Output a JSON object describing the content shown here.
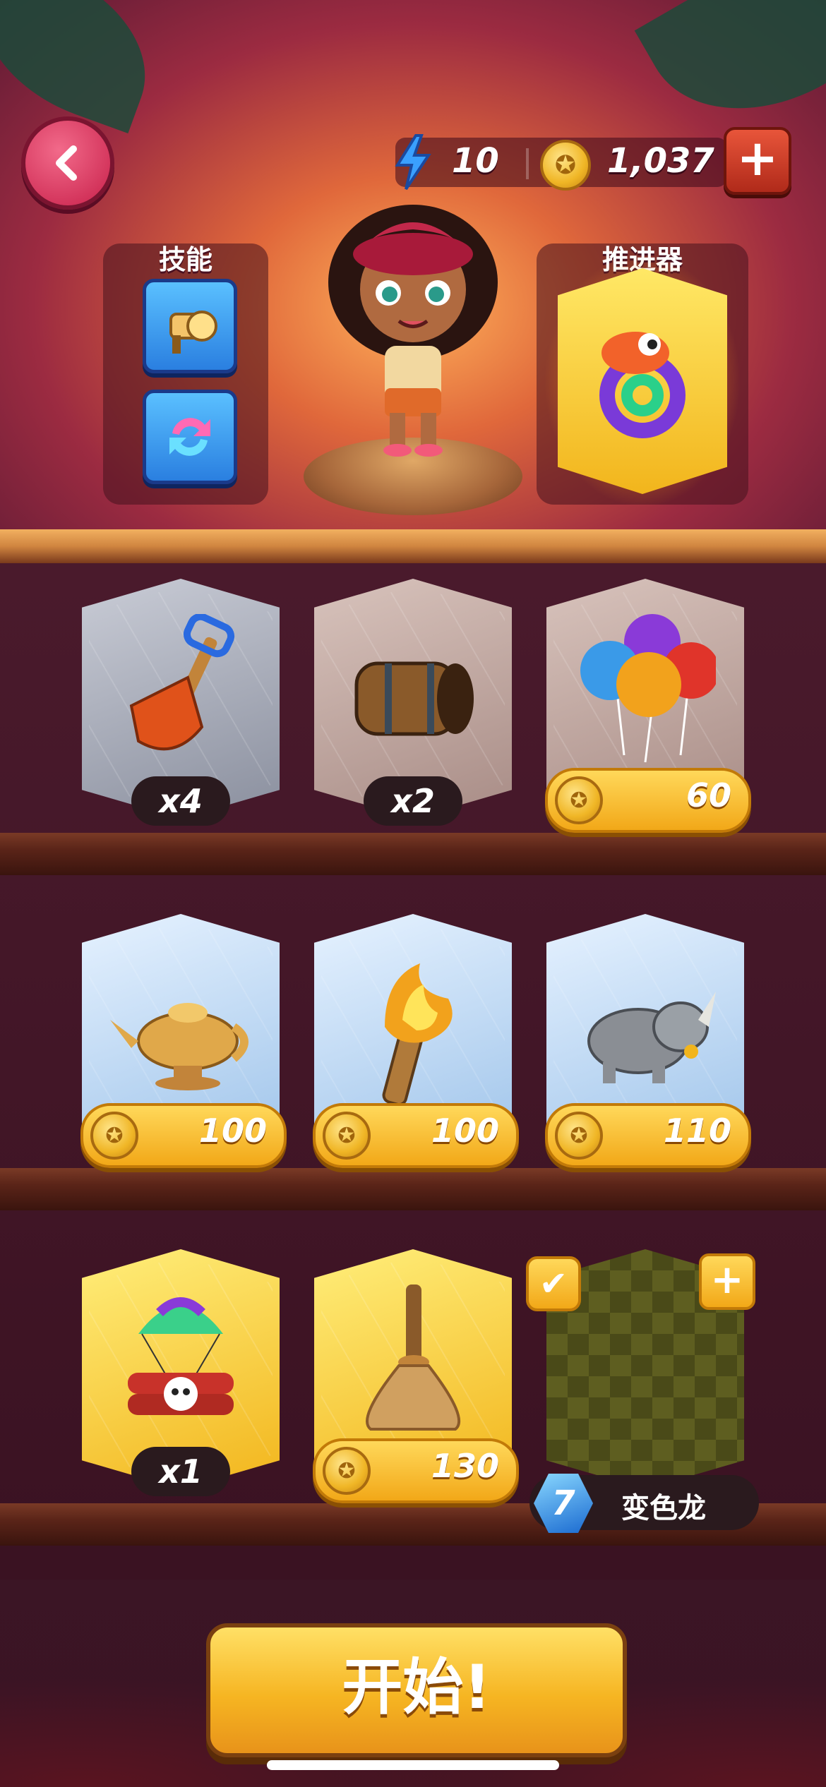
{
  "header": {
    "energy": "10",
    "coins": "1,037",
    "add_label": "+"
  },
  "skills_panel": {
    "title": "技能"
  },
  "booster_panel": {
    "title": "推进器"
  },
  "items": [
    {
      "name": "shovel",
      "badge_type": "quantity",
      "badge": "x4"
    },
    {
      "name": "barrel",
      "badge_type": "quantity",
      "badge": "x2"
    },
    {
      "name": "balloons",
      "badge_type": "price",
      "badge": "60"
    },
    {
      "name": "magic-lamp",
      "badge_type": "price",
      "badge": "100"
    },
    {
      "name": "torch",
      "badge_type": "price",
      "badge": "100"
    },
    {
      "name": "rhino",
      "badge_type": "price",
      "badge": "110"
    },
    {
      "name": "dynamite-parachute",
      "badge_type": "quantity",
      "badge": "x1"
    },
    {
      "name": "broom",
      "badge_type": "price",
      "badge": "130"
    },
    {
      "name": "chameleon-slot",
      "badge_type": "gem",
      "badge": "7",
      "label": "变色龙"
    }
  ],
  "start_button": {
    "label": "开始!"
  },
  "colors": {
    "coin": "#f2b626",
    "accent_red": "#c8204a",
    "gold": "#f6b522"
  }
}
